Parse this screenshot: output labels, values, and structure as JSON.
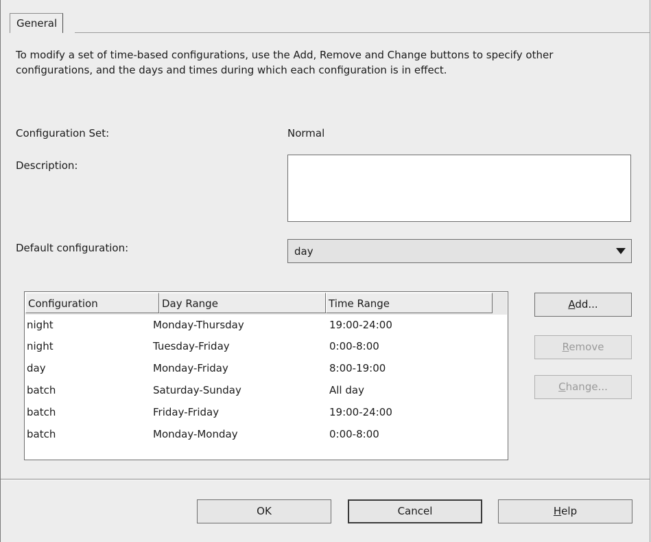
{
  "tabs": {
    "general": "General"
  },
  "instructions": "To modify a set of time-based configurations, use the Add, Remove and Change buttons to specify other configurations, and the days and times during which each configuration is in effect.",
  "form": {
    "config_set_label": "Configuration Set:",
    "config_set_value": "Normal",
    "description_label": "Description:",
    "description_value": "",
    "default_config_label": "Default configuration:",
    "default_config_value": "day"
  },
  "table": {
    "columns": [
      "Configuration",
      "Day Range",
      "Time Range"
    ],
    "rows": [
      {
        "configuration": "night",
        "day_range": "Monday-Thursday",
        "time_range": "19:00-24:00"
      },
      {
        "configuration": "night",
        "day_range": "Tuesday-Friday",
        "time_range": "0:00-8:00"
      },
      {
        "configuration": "day",
        "day_range": "Monday-Friday",
        "time_range": "8:00-19:00"
      },
      {
        "configuration": "batch",
        "day_range": "Saturday-Sunday",
        "time_range": "All day"
      },
      {
        "configuration": "batch",
        "day_range": "Friday-Friday",
        "time_range": "19:00-24:00"
      },
      {
        "configuration": "batch",
        "day_range": "Monday-Monday",
        "time_range": "0:00-8:00"
      }
    ]
  },
  "side_buttons": {
    "add_mnemonic": "A",
    "add_rest": "dd...",
    "remove_mnemonic": "R",
    "remove_rest": "emove",
    "change_mnemonic": "C",
    "change_rest": "hange..."
  },
  "footer": {
    "ok": "OK",
    "cancel": "Cancel",
    "help_mnemonic": "H",
    "help_rest": "elp"
  },
  "icons": {
    "dropdown": "chevron-down-icon"
  }
}
